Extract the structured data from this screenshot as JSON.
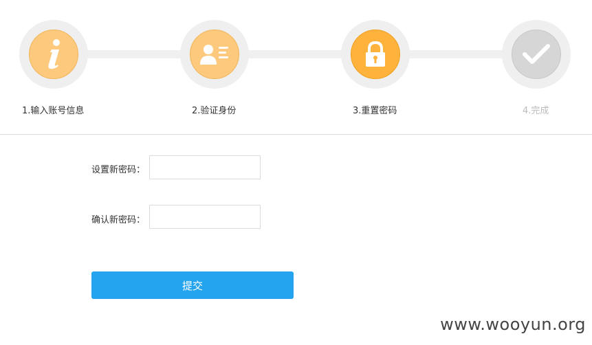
{
  "steps": [
    {
      "label": "1.输入账号信息",
      "state": "done",
      "icon": "info-icon"
    },
    {
      "label": "2.验证身份",
      "state": "done",
      "icon": "id-card-icon"
    },
    {
      "label": "3.重置密码",
      "state": "active",
      "icon": "lock-icon"
    },
    {
      "label": "4.完成",
      "state": "todo",
      "icon": "checkmark-icon"
    }
  ],
  "form": {
    "new_password_label": "设置新密码：",
    "confirm_password_label": "确认新密码：",
    "new_password_value": "",
    "confirm_password_value": "",
    "submit_label": "提交"
  },
  "watermark": "www.wooyun.org",
  "colors": {
    "step_done": "#fcc97d",
    "step_active": "#ffb23c",
    "step_todo": "#d6d6d6",
    "primary_button": "#24a3ee"
  }
}
